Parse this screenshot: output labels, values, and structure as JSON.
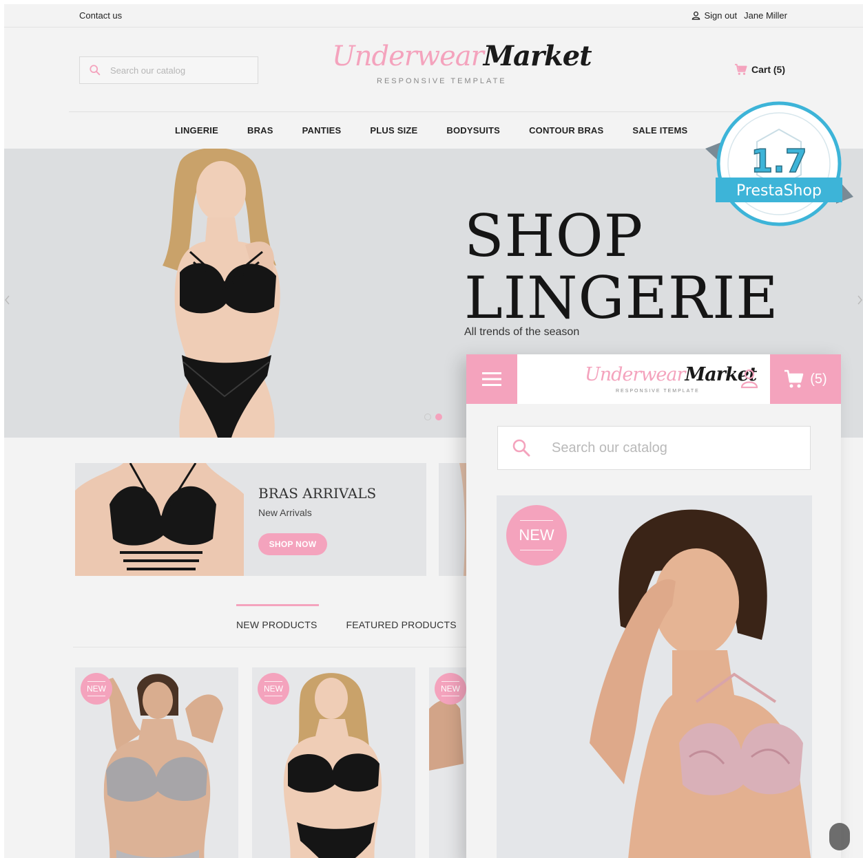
{
  "topbar": {
    "contact": "Contact us",
    "signout": "Sign out",
    "user_name": "Jane Miller"
  },
  "header": {
    "search_placeholder": "Search our catalog",
    "logo_part1": "Underwear",
    "logo_part2": "Market",
    "logo_tagline": "RESPONSIVE TEMPLATE",
    "cart_label": "Cart (5)"
  },
  "nav": {
    "items": [
      {
        "label": "LINGERIE"
      },
      {
        "label": "BRAS"
      },
      {
        "label": "PANTIES"
      },
      {
        "label": "PLUS SIZE"
      },
      {
        "label": "BODYSUITS"
      },
      {
        "label": "CONTOUR BRAS"
      },
      {
        "label": "SALE ITEMS"
      }
    ]
  },
  "hero": {
    "title_line1": "SHOP",
    "title_line2": "LINGERIE",
    "subtitle": "All trends of the season",
    "slide_count": 2,
    "active_slide": 2
  },
  "badge": {
    "version": "1.7",
    "platform": "PrestaShop"
  },
  "banner": {
    "title": "BRAS ARRIVALS",
    "subtitle": "New Arrivals",
    "button": "SHOP NOW"
  },
  "tabs": {
    "items": [
      {
        "label": "NEW PRODUCTS",
        "active": true
      },
      {
        "label": "FEATURED PRODUCTS",
        "active": false
      }
    ]
  },
  "products": [
    {
      "badge": "NEW"
    },
    {
      "badge": "NEW"
    },
    {
      "badge": "NEW"
    }
  ],
  "mobile": {
    "logo_part1": "Underwear",
    "logo_part2": "Market",
    "logo_tagline": "RESPONSIVE TEMPLATE",
    "cart_count": "(5)",
    "search_placeholder": "Search our catalog",
    "product_badge": "NEW"
  },
  "colors": {
    "accent_pink": "#f4a3bd",
    "badge_blue": "#3db4d8",
    "text_dark": "#151515"
  }
}
